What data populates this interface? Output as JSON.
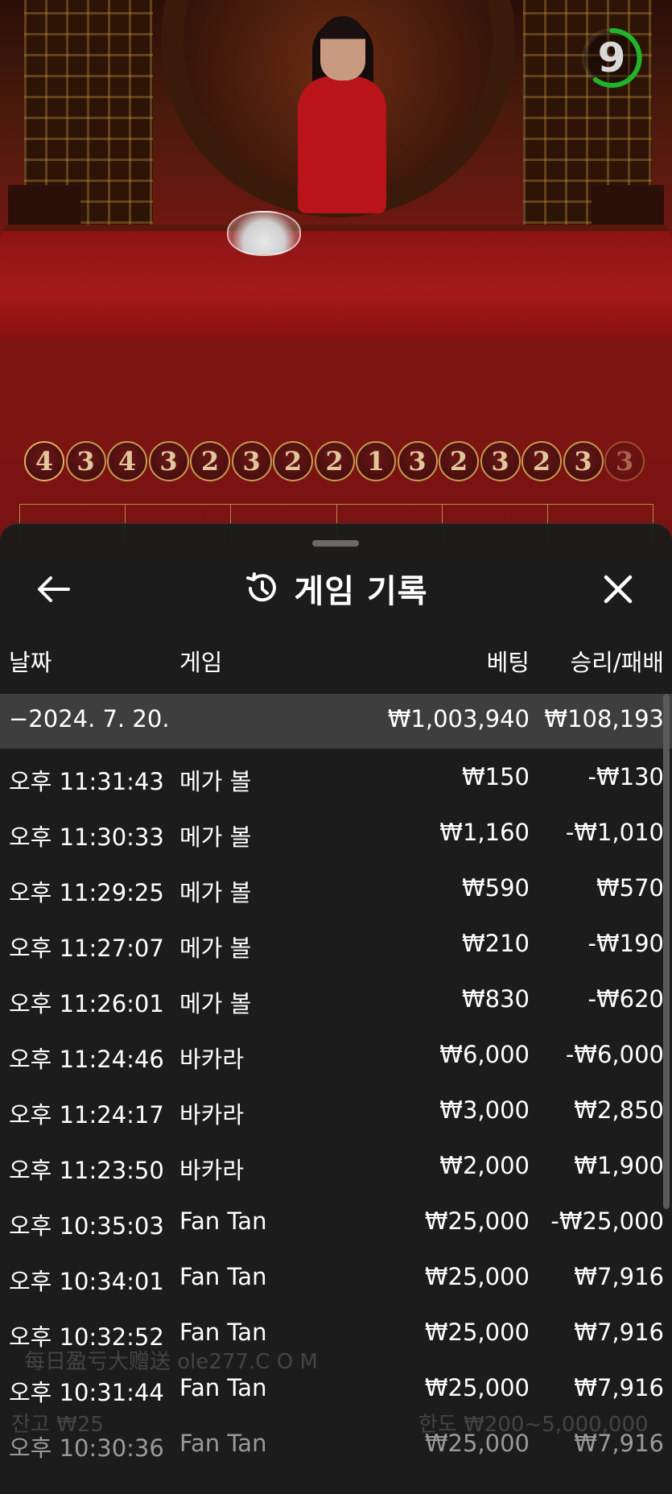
{
  "timer": {
    "value": "9",
    "ring_color": "#1fb52a"
  },
  "beads": [
    "4",
    "3",
    "4",
    "3",
    "2",
    "3",
    "2",
    "2",
    "1",
    "3",
    "2",
    "3",
    "2",
    "3",
    "3"
  ],
  "sheet": {
    "title": "게임 기록",
    "back_icon": "arrow-left-icon",
    "history_icon": "history-clock-icon",
    "close_icon": "close-icon"
  },
  "columns": {
    "date": "날짜",
    "game": "게임",
    "bet": "베팅",
    "win_loss": "승리/패배"
  },
  "group": {
    "date": "−2024. 7. 20.",
    "bet": "₩1,003,940",
    "win_loss": "₩108,193"
  },
  "rows": [
    {
      "time": "오후 11:31:43",
      "game": "메가 볼",
      "bet": "₩150",
      "win_loss": "-₩130"
    },
    {
      "time": "오후 11:30:33",
      "game": "메가 볼",
      "bet": "₩1,160",
      "win_loss": "-₩1,010"
    },
    {
      "time": "오후 11:29:25",
      "game": "메가 볼",
      "bet": "₩590",
      "win_loss": "₩570"
    },
    {
      "time": "오후 11:27:07",
      "game": "메가 볼",
      "bet": "₩210",
      "win_loss": "-₩190"
    },
    {
      "time": "오후 11:26:01",
      "game": "메가 볼",
      "bet": "₩830",
      "win_loss": "-₩620"
    },
    {
      "time": "오후 11:24:46",
      "game": "바카라",
      "bet": "₩6,000",
      "win_loss": "-₩6,000"
    },
    {
      "time": "오후 11:24:17",
      "game": "바카라",
      "bet": "₩3,000",
      "win_loss": "₩2,850"
    },
    {
      "time": "오후 11:23:50",
      "game": "바카라",
      "bet": "₩2,000",
      "win_loss": "₩1,900"
    },
    {
      "time": "오후 10:35:03",
      "game": "Fan Tan",
      "bet": "₩25,000",
      "win_loss": "-₩25,000"
    },
    {
      "time": "오후 10:34:01",
      "game": "Fan Tan",
      "bet": "₩25,000",
      "win_loss": "₩7,916"
    },
    {
      "time": "오후 10:32:52",
      "game": "Fan Tan",
      "bet": "₩25,000",
      "win_loss": "₩7,916"
    },
    {
      "time": "오후 10:31:44",
      "game": "Fan Tan",
      "bet": "₩25,000",
      "win_loss": "₩7,916"
    },
    {
      "time": "오후 10:30:36",
      "game": "Fan Tan",
      "bet": "₩25,000",
      "win_loss": "₩7,916"
    }
  ],
  "ghost_texts": {
    "watermark": "每日盈亏大赠送 ole277.C O M",
    "balance": "잔고 ₩25",
    "limits": "한도 ₩200~5,000,000"
  },
  "colors": {
    "sheet_bg": "#1c1c1c",
    "group_row_bg": "#3e3e3e",
    "bead_border": "#c79a50",
    "felt": "#7d1512"
  }
}
